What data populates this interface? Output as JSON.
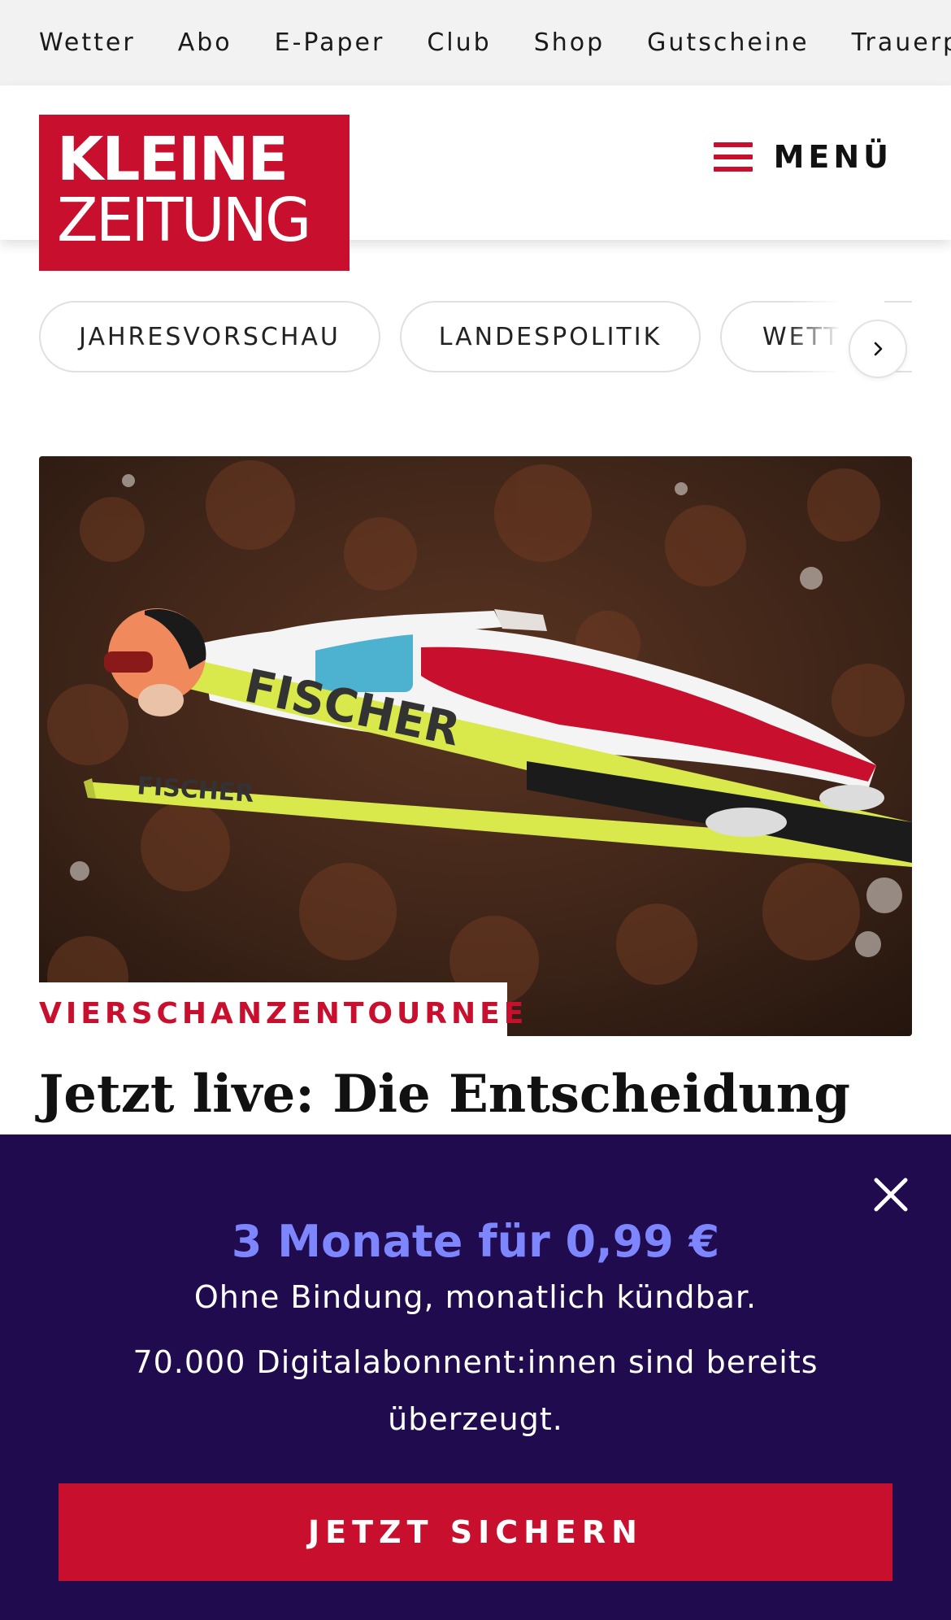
{
  "top_nav": {
    "items": [
      "Wetter",
      "Abo",
      "E-Paper",
      "Club",
      "Shop",
      "Gutscheine",
      "Trauerportal"
    ]
  },
  "header": {
    "logo_line1": "KLEINE",
    "logo_line2": "ZEITUNG",
    "menu_label": "MENÜ",
    "menu_icon": "hamburger-icon",
    "accent_color": "#c8102e"
  },
  "tags": {
    "items": [
      "JAHRESVORSCHAU",
      "LANDESPOLITIK",
      "WETTER"
    ],
    "next_icon": "chevron-right-icon"
  },
  "article": {
    "kicker": "VIERSCHANZENTOURNEE",
    "headline": "Jetzt live: Die Entscheidung",
    "image_alt": "ski-jumper-photo"
  },
  "promo": {
    "title": "3 Monate für 0,99 €",
    "subtitle": "Ohne Bindung, monatlich kündbar.",
    "description": "70.000 Digitalabonnent:innen sind bereits überzeugt.",
    "cta_label": "JETZT SICHERN",
    "close_icon": "close-icon",
    "background_color": "#1f0b4d",
    "title_color": "#7d86ff"
  }
}
